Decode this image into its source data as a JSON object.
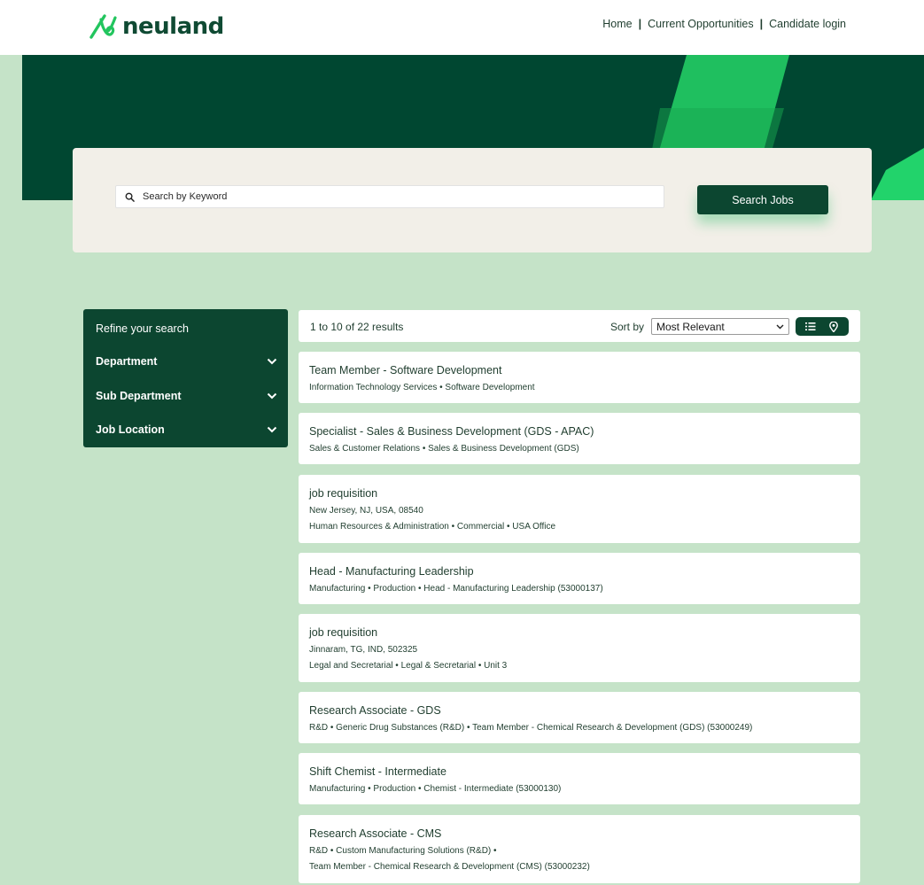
{
  "brand": {
    "logo_text": "neuland"
  },
  "top_nav": {
    "home": "Home",
    "opportunities": "Current Opportunities",
    "login": "Candidate login",
    "separator": "|"
  },
  "search": {
    "placeholder": "Search by Keyword",
    "value": "",
    "button_label": "Search Jobs"
  },
  "sidebar": {
    "title": "Refine your search",
    "filters": [
      {
        "label": "Department"
      },
      {
        "label": "Sub Department"
      },
      {
        "label": "Job Location"
      }
    ]
  },
  "results": {
    "count_text": "1 to 10 of 22 results",
    "sort_label": "Sort by",
    "sort_value": "Most Relevant",
    "view_icons": [
      "list-view-icon",
      "map-pin-icon"
    ]
  },
  "jobs": [
    {
      "title": "Team Member - Software Development",
      "lines": [
        "Information Technology Services  •  Software Development"
      ]
    },
    {
      "title": "Specialist - Sales & Business Development (GDS - APAC)",
      "lines": [
        "Sales & Customer Relations  •  Sales & Business Development (GDS)"
      ]
    },
    {
      "title": "job requisition",
      "lines": [
        "New Jersey, NJ, USA, 08540",
        "Human Resources & Administration  •  Commercial  •  USA Office"
      ]
    },
    {
      "title": "Head - Manufacturing Leadership",
      "lines": [
        "Manufacturing  •  Production  •  Head - Manufacturing Leadership (53000137)"
      ]
    },
    {
      "title": "job requisition",
      "lines": [
        "Jinnaram, TG, IND, 502325",
        "Legal and Secretarial  •  Legal & Secretarial  •  Unit 3"
      ]
    },
    {
      "title": "Research Associate - GDS",
      "lines": [
        "R&D  •  Generic Drug Substances (R&D)  •  Team Member - Chemical Research & Development (GDS) (53000249)"
      ]
    },
    {
      "title": "Shift Chemist - Intermediate",
      "lines": [
        "Manufacturing  •  Production  •  Chemist - Intermediate (53000130)"
      ]
    },
    {
      "title": "Research Associate - CMS",
      "lines": [
        "R&D  •  Custom Manufacturing Solutions (R&D)  •",
        "Team Member - Chemical Research & Development (CMS) (53000232)"
      ]
    }
  ],
  "colors": {
    "dark_green": "#004731",
    "panel_green": "#0c4630",
    "bright_green": "#22d36b",
    "page_bg": "#c5e3c8",
    "search_panel_bg": "#f2efe8"
  }
}
